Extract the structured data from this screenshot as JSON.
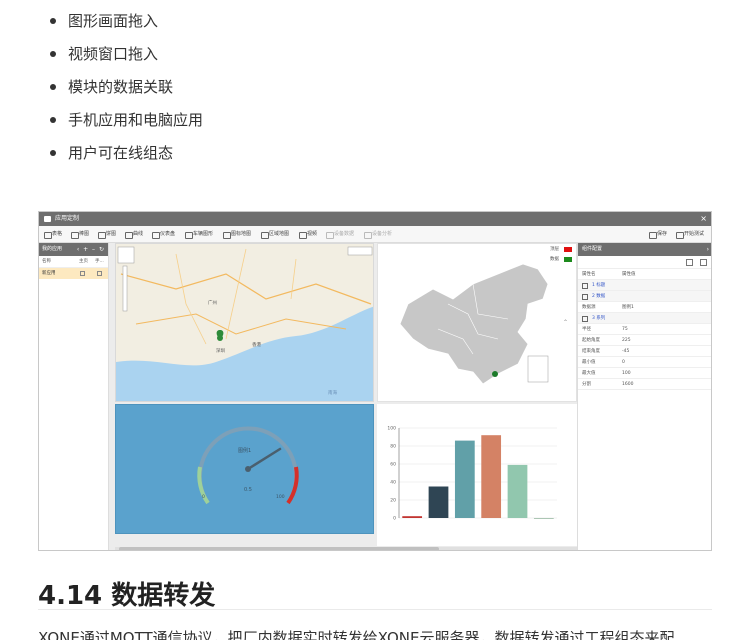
{
  "bullets": [
    "图形画面拖入",
    "视频窗口拖入",
    "模块的数据关联",
    "手机应用和电脑应用",
    "用户可在线组态"
  ],
  "app": {
    "title": "应用定制",
    "toolbar": [
      "表格",
      "棒图",
      "饼图",
      "曲线",
      "仪表盘",
      "车辆图形",
      "图标地图",
      "区域地图",
      "视频",
      "设备数据",
      "设备分析"
    ],
    "toolbar_right": [
      "保存",
      "开始测试"
    ],
    "left_panel": {
      "title": "我的应用",
      "columns": [
        "名称",
        "主页",
        "手..."
      ],
      "rows": [
        {
          "name": "新应用"
        }
      ]
    },
    "map": {
      "labels": [
        "广州",
        "深圳",
        "香港",
        "南海"
      ]
    },
    "china_legend": [
      "顶层",
      "数据"
    ],
    "gauge": {
      "label": "图例1",
      "value_text": "0.5",
      "min": "0",
      "max": "100"
    },
    "right_panel": {
      "title": "组件配置",
      "rows": [
        {
          "k": "属性名",
          "v": "属性值"
        },
        {
          "k": "1 标题",
          "group": true
        },
        {
          "k": "2 数据",
          "group": true
        },
        {
          "k": "数据源",
          "v": "图例1"
        },
        {
          "k": "3 系列",
          "group": true
        },
        {
          "k": "半径",
          "v": "75"
        },
        {
          "k": "起始角度",
          "v": "225"
        },
        {
          "k": "结束角度",
          "v": "-45"
        },
        {
          "k": "最小值",
          "v": "0"
        },
        {
          "k": "最大值",
          "v": "100"
        },
        {
          "k": "分割",
          "v": "1600"
        }
      ]
    }
  },
  "chart_data": {
    "type": "bar",
    "categories": [
      "",
      "",
      "",
      "",
      "",
      ""
    ],
    "values": [
      2,
      35,
      86,
      92,
      59,
      0
    ],
    "colors": [
      "#c23531",
      "#2f4554",
      "#61a0a8",
      "#d48265",
      "#91c7ae",
      "#749f83"
    ],
    "ylim": [
      0,
      100
    ],
    "yticks": [
      "0",
      "20",
      "40",
      "60",
      "80",
      "100"
    ]
  },
  "section": {
    "title": "4.14 数据转发"
  },
  "paragraph": "XONE通过MQTT通信协议，把厂内数据实时转发给XONE云服务器，数据转发通过工程组态来配"
}
